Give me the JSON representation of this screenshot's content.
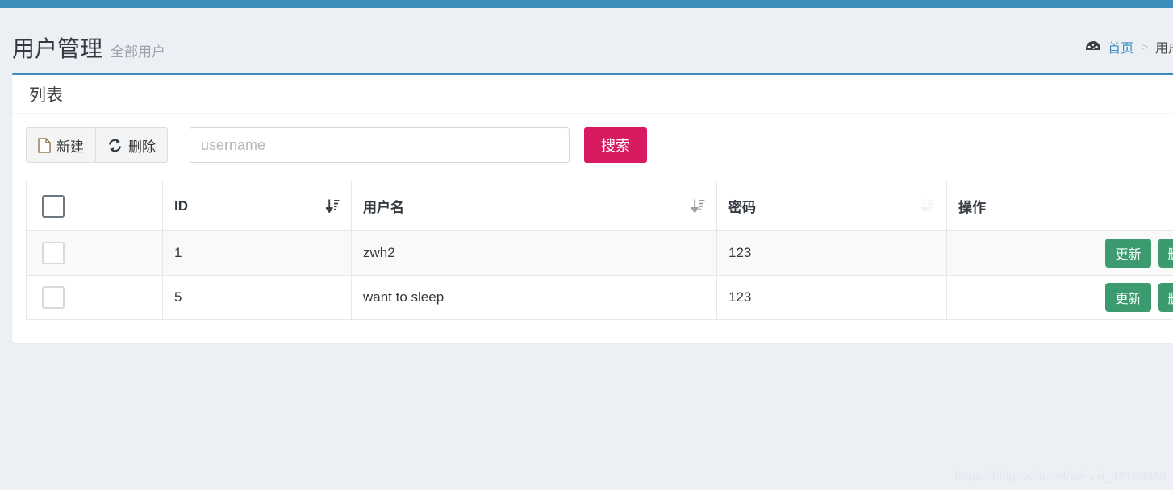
{
  "theme": {
    "topbar_color": "#3c8dbc",
    "page_bg": "#ecf0f5",
    "accent_blue": "#3c8dbc",
    "search_btn_color": "#d81b60",
    "op_btn_color": "#3c9b6e"
  },
  "header": {
    "title": "用户管理",
    "subtitle": "全部用户",
    "breadcrumb": {
      "icon": "tachometer-icon",
      "home_label": "首页",
      "separator": ">",
      "current_label": "用户管"
    }
  },
  "box": {
    "title": "列表",
    "toolbar": {
      "new_label": "新建",
      "new_icon": "file-icon",
      "delete_label": "删除",
      "delete_icon": "refresh-icon",
      "search_placeholder": "username",
      "search_value": "",
      "search_button_label": "搜索"
    },
    "table": {
      "columns": [
        {
          "key": "check",
          "label": "",
          "sort": "none"
        },
        {
          "key": "id",
          "label": "ID",
          "sort": "desc-active"
        },
        {
          "key": "username",
          "label": "用户名",
          "sort": "desc-gray"
        },
        {
          "key": "password",
          "label": "密码",
          "sort": "desc-faint"
        },
        {
          "key": "ops",
          "label": "操作",
          "sort": "none"
        }
      ],
      "rows": [
        {
          "id": "1",
          "username": "zwh2",
          "password": "123",
          "update_label": "更新",
          "delete_label": "删除"
        },
        {
          "id": "5",
          "username": "want to sleep",
          "password": "123",
          "update_label": "更新",
          "delete_label": "删除"
        }
      ]
    }
  },
  "watermark": "https://blog.csdn.net/weixin_42189888"
}
